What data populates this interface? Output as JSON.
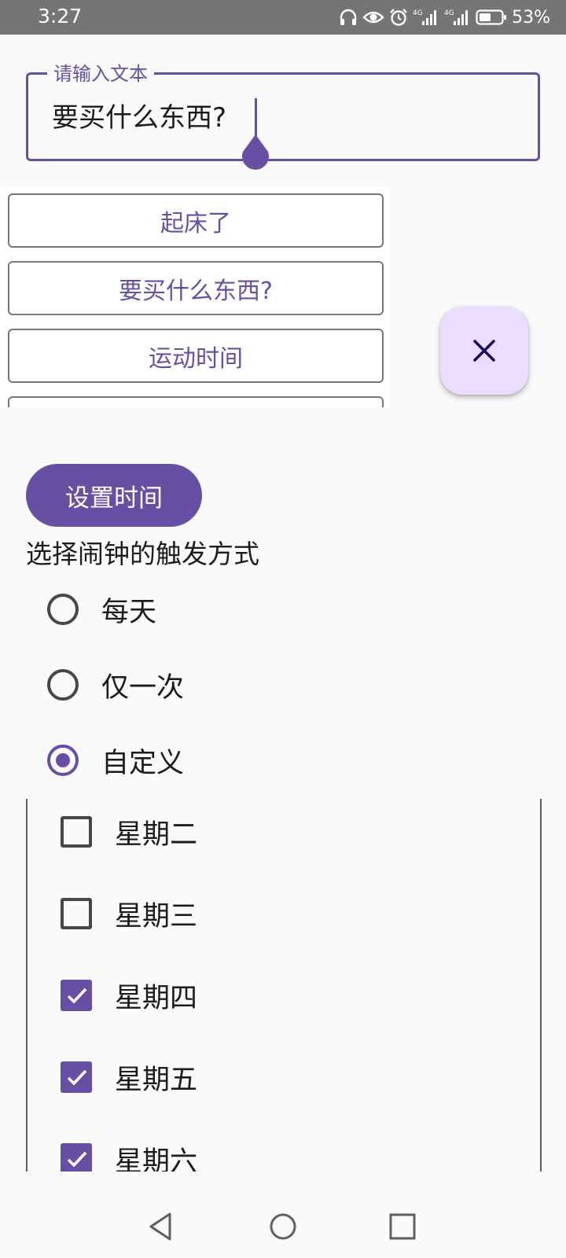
{
  "status_bar": {
    "time": "3:27",
    "icons": [
      "headphones-icon",
      "eye-icon",
      "alarm-icon",
      "signal-4g-icon",
      "signal-4g-icon",
      "battery-icon"
    ],
    "battery": "53%"
  },
  "input": {
    "label": "请输入文本",
    "value": "要买什么东西?"
  },
  "suggestions": [
    {
      "label": "起床了"
    },
    {
      "label": "要买什么东西?"
    },
    {
      "label": "运动时间"
    }
  ],
  "fab": {
    "icon": "close-icon"
  },
  "set_time_button": {
    "label": "设置时间"
  },
  "trigger_section": {
    "title": "选择闹钟的触发方式",
    "options": [
      {
        "label": "每天",
        "checked": false
      },
      {
        "label": "仅一次",
        "checked": false
      },
      {
        "label": "自定义",
        "checked": true
      }
    ]
  },
  "days": [
    {
      "label": "星期二",
      "checked": false
    },
    {
      "label": "星期三",
      "checked": false
    },
    {
      "label": "星期四",
      "checked": true
    },
    {
      "label": "星期五",
      "checked": true
    },
    {
      "label": "星期六",
      "checked": true
    }
  ],
  "nav_bar": {
    "icons": [
      "back-icon",
      "home-icon",
      "recents-icon"
    ]
  },
  "colors": {
    "primary": "#6750a4",
    "primary_container": "#eaddff",
    "status_bar": "#757575"
  }
}
